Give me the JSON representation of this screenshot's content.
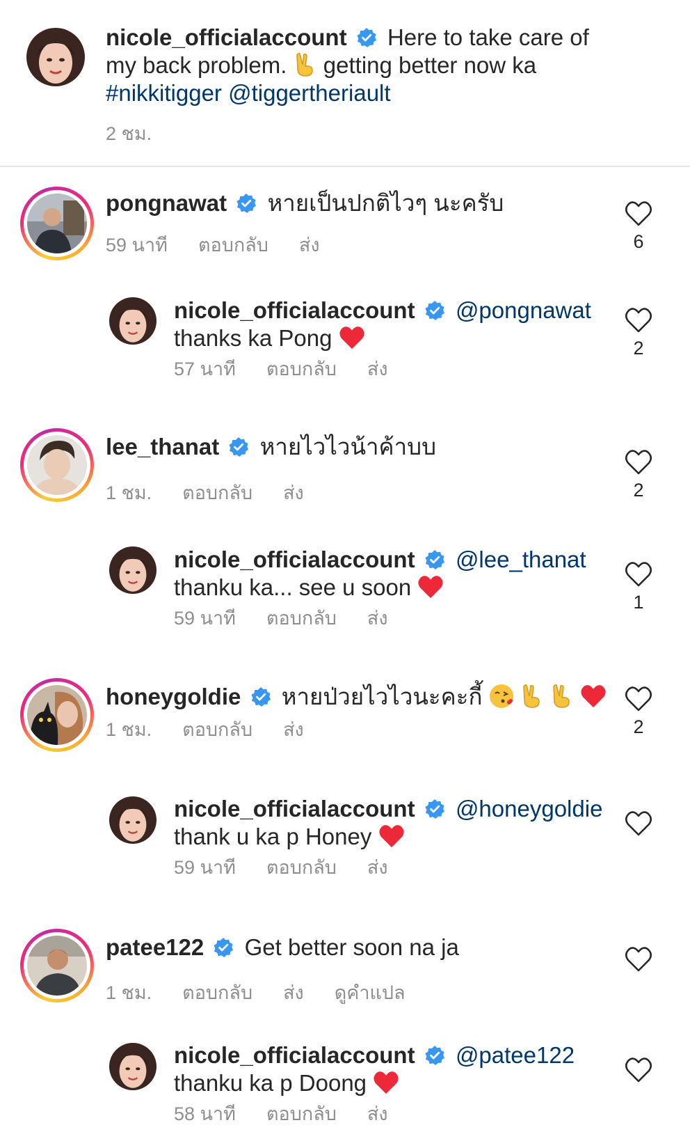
{
  "caption": {
    "username": "nicole_officialaccount",
    "text_1": "Here to take care of",
    "text_2a": "my back problem.",
    "text_2b": "getting better now ka",
    "hashtag": "#nikkitigger",
    "mention": "@tiggertheriault",
    "time": "2 ชม."
  },
  "labels": {
    "reply": "ตอบกลับ",
    "send": "ส่ง",
    "translate": "ดูคำแปล"
  },
  "comments": [
    {
      "username": "pongnawat",
      "text": "หายเป็นปกติไวๆ นะครับ",
      "time": "59 นาที",
      "likes": "6"
    },
    {
      "username": "nicole_officialaccount",
      "mention": "@pongnawat",
      "text": "thanks ka Pong",
      "time": "57 นาที",
      "likes": "2"
    },
    {
      "username": "lee_thanat",
      "text": "หายไวไวน้าค้าบบ",
      "time": "1 ชม.",
      "likes": "2"
    },
    {
      "username": "nicole_officialaccount",
      "mention": "@lee_thanat",
      "text": "thanku ka... see u soon",
      "time": "59 นาที",
      "likes": "1"
    },
    {
      "username": "honeygoldie",
      "text": "หายป่วยไวไวนะคะกี้",
      "time": "1 ชม.",
      "likes": "2"
    },
    {
      "username": "nicole_officialaccount",
      "mention": "@honeygoldie",
      "text": "thank u ka p Honey",
      "time": "59 นาที",
      "likes": ""
    },
    {
      "username": "patee122",
      "text": "Get better soon na ja",
      "time": "1 ชม.",
      "likes": ""
    },
    {
      "username": "nicole_officialaccount",
      "mention": "@patee122",
      "text": "thanku ka p Doong",
      "time": "58 นาที",
      "likes": ""
    }
  ],
  "colors": {
    "text": "#262626",
    "meta": "#8e8e8e",
    "link": "#00376b",
    "verified": "#3897f0",
    "heart": "#ed2939"
  }
}
